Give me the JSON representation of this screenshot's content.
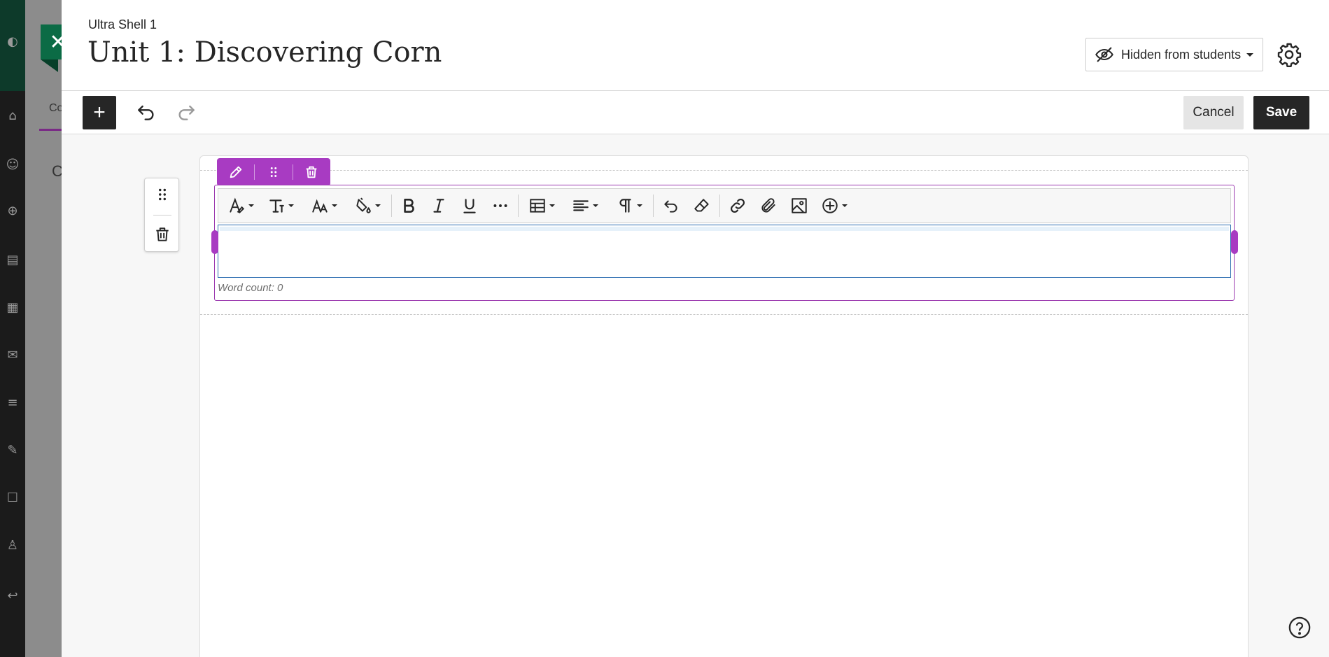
{
  "header": {
    "course_name": "Ultra Shell 1",
    "title": "Unit 1: Discovering Corn",
    "visibility_label": "Hidden from students",
    "icons": {
      "visibility": "eye-off-icon",
      "settings": "gear-icon",
      "close": "close-icon"
    }
  },
  "toolbar": {
    "add_label": "+",
    "cancel_label": "Cancel",
    "save_label": "Save"
  },
  "background": {
    "tab_partial": "Co",
    "heading_partial": "C"
  },
  "editor": {
    "content": "",
    "word_count": "Word count: 0",
    "toolbar_icons": [
      "text-style-icon",
      "paragraph-format-icon",
      "font-size-icon",
      "highlight-color-icon",
      "bold-icon",
      "italic-icon",
      "underline-icon",
      "more-formatting-icon",
      "table-icon",
      "align-icon",
      "paragraph-icon",
      "undo-icon",
      "clear-format-icon",
      "link-icon",
      "attach-icon",
      "image-icon",
      "insert-content-icon"
    ]
  },
  "colors": {
    "accent_purple": "#a83bc2",
    "close_green": "#0b6b45",
    "dark_button": "#262626"
  }
}
